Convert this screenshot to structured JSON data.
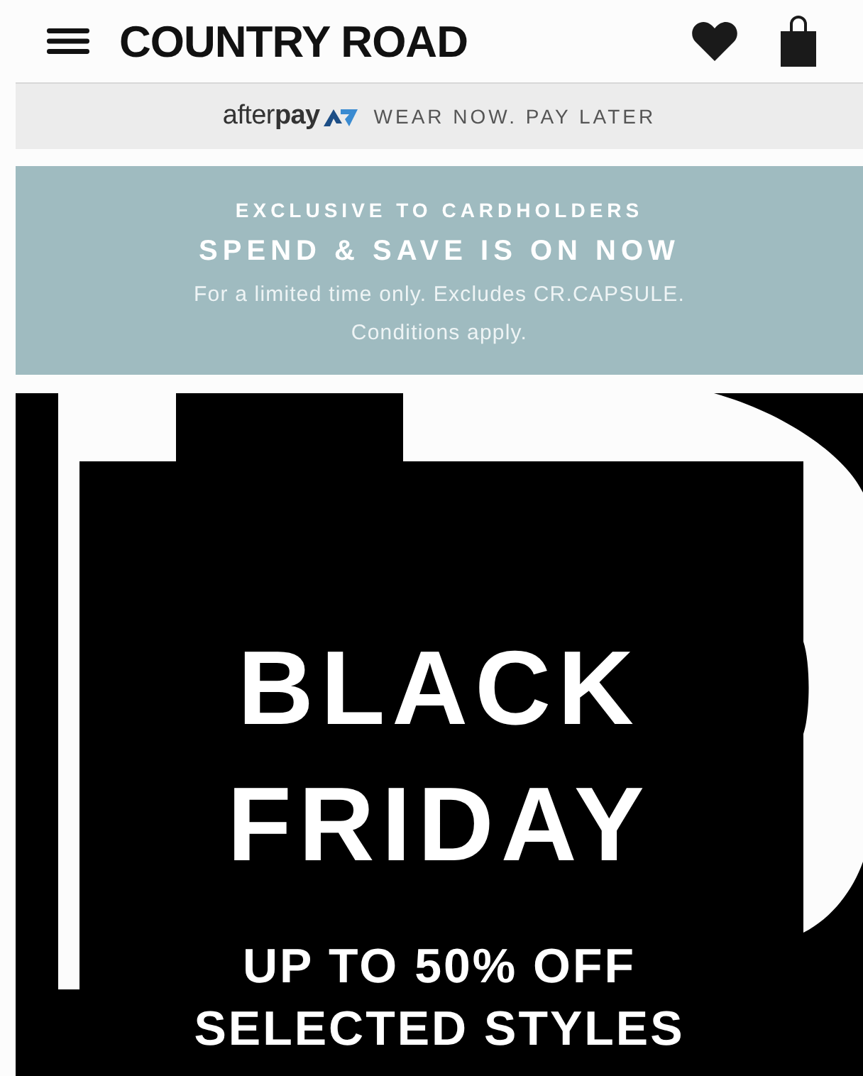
{
  "header": {
    "brand": "COUNTRY ROAD"
  },
  "afterpay_bar": {
    "logo": "after**pay**",
    "tagline": "WEAR NOW. PAY LATER"
  },
  "promo_banner": {
    "eyebrow": "EXCLUSIVE TO CARDHOLDERS",
    "headline": "SPEND & SAVE IS ON NOW",
    "details": [
      "For a limited time only. Excludes CR.CAPSULE.",
      "Conditions apply."
    ]
  },
  "hero": {
    "title_lines": [
      "BLACK",
      "FRIDAY"
    ],
    "subtitle_lines": [
      "UP TO 50% OFF",
      "SELECTED STYLES"
    ]
  }
}
